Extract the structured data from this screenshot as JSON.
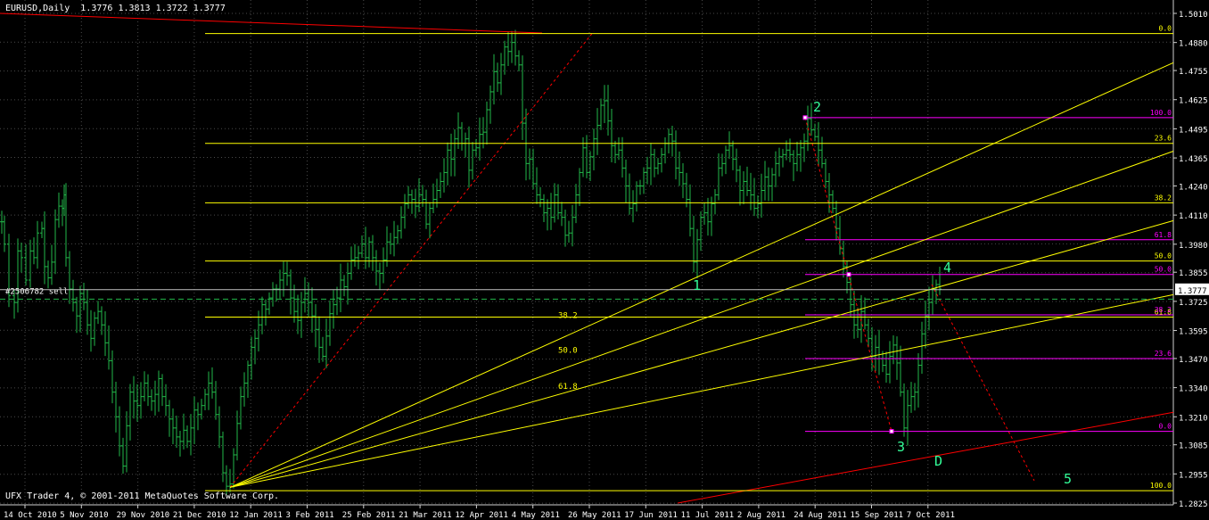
{
  "header": {
    "symbol_tf": "EURUSD,Daily",
    "ohlc": "1.3776 1.3813 1.3722 1.3777"
  },
  "footer": "UFX Trader 4, © 2001-2011 MetaQuotes Software Corp.",
  "colors": {
    "background": "#000000",
    "bars": "#22b84a",
    "grid": "#4a4a4a",
    "axis_text": "#ffffff",
    "fib_yellow": "#ffff00",
    "fib_magenta": "#ff00ff",
    "trend_red": "#ff0000",
    "wave_labels": "#33ff99",
    "price_tag_bg": "#ffffff"
  },
  "chart_data": {
    "type": "ohlc",
    "symbol": "EURUSD",
    "timeframe": "Daily",
    "grid": true,
    "current_price": "1.3777",
    "y_ticks": [
      "1.5010",
      "1.4880",
      "1.4755",
      "1.4625",
      "1.4495",
      "1.4365",
      "1.4240",
      "1.4110",
      "1.3980",
      "1.3855",
      "1.3725",
      "1.3595",
      "1.3470",
      "1.3340",
      "1.3210",
      "1.3085",
      "1.2955",
      "1.2825"
    ],
    "x_ticks": [
      "14 Oct 2010",
      "5 Nov 2010",
      "29 Nov 2010",
      "21 Dec 2010",
      "12 Jan 2011",
      "3 Feb 2011",
      "25 Feb 2011",
      "21 Mar 2011",
      "12 Apr 2011",
      "4 May 2011",
      "26 May 2011",
      "17 Jun 2011",
      "11 Jul 2011",
      "2 Aug 2011",
      "24 Aug 2011",
      "15 Sep 2011",
      "7 Oct 2011"
    ],
    "ylim": [
      1.2825,
      1.501
    ],
    "close_series": [
      [
        0,
        1.408
      ],
      [
        3,
        1.398
      ],
      [
        8,
        1.375
      ],
      [
        14,
        1.372
      ],
      [
        18,
        1.395
      ],
      [
        22,
        1.392
      ],
      [
        27,
        1.382
      ],
      [
        32,
        1.395
      ],
      [
        36,
        1.392
      ],
      [
        40,
        1.403
      ],
      [
        45,
        1.405
      ],
      [
        48,
        1.388
      ],
      [
        52,
        1.383
      ],
      [
        56,
        1.39
      ],
      [
        60,
        1.409
      ],
      [
        64,
        1.415
      ],
      [
        68,
        1.414
      ],
      [
        70,
        1.42
      ],
      [
        72,
        1.392
      ],
      [
        76,
        1.378
      ],
      [
        80,
        1.372
      ],
      [
        84,
        1.366
      ],
      [
        88,
        1.376
      ],
      [
        92,
        1.372
      ],
      [
        96,
        1.362
      ],
      [
        100,
        1.356
      ],
      [
        104,
        1.365
      ],
      [
        108,
        1.368
      ],
      [
        112,
        1.362
      ],
      [
        116,
        1.354
      ],
      [
        120,
        1.346
      ],
      [
        124,
        1.332
      ],
      [
        128,
        1.321
      ],
      [
        132,
        1.308
      ],
      [
        136,
        1.299
      ],
      [
        140,
        1.317
      ],
      [
        144,
        1.332
      ],
      [
        148,
        1.328
      ],
      [
        152,
        1.326
      ],
      [
        156,
        1.33
      ],
      [
        160,
        1.336
      ],
      [
        164,
        1.33
      ],
      [
        168,
        1.328
      ],
      [
        172,
        1.331
      ],
      [
        176,
        1.338
      ],
      [
        180,
        1.33
      ],
      [
        184,
        1.326
      ],
      [
        188,
        1.32
      ],
      [
        192,
        1.316
      ],
      [
        196,
        1.312
      ],
      [
        200,
        1.31
      ],
      [
        204,
        1.315
      ],
      [
        208,
        1.31
      ],
      [
        212,
        1.316
      ],
      [
        216,
        1.324
      ],
      [
        220,
        1.322
      ],
      [
        224,
        1.326
      ],
      [
        228,
        1.331
      ],
      [
        232,
        1.336
      ],
      [
        236,
        1.332
      ],
      [
        240,
        1.322
      ],
      [
        244,
        1.312
      ],
      [
        248,
        1.296
      ],
      [
        252,
        1.29
      ],
      [
        256,
        1.291
      ],
      [
        260,
        1.304
      ],
      [
        264,
        1.318
      ],
      [
        268,
        1.33
      ],
      [
        272,
        1.336
      ],
      [
        276,
        1.344
      ],
      [
        280,
        1.352
      ],
      [
        284,
        1.356
      ],
      [
        288,
        1.362
      ],
      [
        292,
        1.371
      ],
      [
        296,
        1.369
      ],
      [
        300,
        1.374
      ],
      [
        304,
        1.378
      ],
      [
        308,
        1.378
      ],
      [
        312,
        1.382
      ],
      [
        316,
        1.385
      ],
      [
        320,
        1.384
      ],
      [
        324,
        1.374
      ],
      [
        328,
        1.368
      ],
      [
        332,
        1.364
      ],
      [
        336,
        1.372
      ],
      [
        340,
        1.376
      ],
      [
        344,
        1.372
      ],
      [
        348,
        1.366
      ],
      [
        352,
        1.36
      ],
      [
        356,
        1.352
      ],
      [
        360,
        1.348
      ],
      [
        364,
        1.357
      ],
      [
        368,
        1.367
      ],
      [
        372,
        1.371
      ],
      [
        376,
        1.374
      ],
      [
        380,
        1.382
      ],
      [
        384,
        1.379
      ],
      [
        388,
        1.385
      ],
      [
        392,
        1.391
      ],
      [
        396,
        1.392
      ],
      [
        400,
        1.394
      ],
      [
        404,
        1.398
      ],
      [
        408,
        1.392
      ],
      [
        412,
        1.399
      ],
      [
        416,
        1.392
      ],
      [
        420,
        1.386
      ],
      [
        424,
        1.385
      ],
      [
        428,
        1.391
      ],
      [
        432,
        1.399
      ],
      [
        436,
        1.398
      ],
      [
        440,
        1.401
      ],
      [
        444,
        1.404
      ],
      [
        448,
        1.41
      ],
      [
        452,
        1.416
      ],
      [
        456,
        1.42
      ],
      [
        460,
        1.418
      ],
      [
        464,
        1.415
      ],
      [
        468,
        1.42
      ],
      [
        472,
        1.418
      ],
      [
        476,
        1.407
      ],
      [
        480,
        1.414
      ],
      [
        484,
        1.418
      ],
      [
        488,
        1.422
      ],
      [
        492,
        1.426
      ],
      [
        496,
        1.43
      ],
      [
        500,
        1.44
      ],
      [
        504,
        1.436
      ],
      [
        508,
        1.445
      ],
      [
        512,
        1.45
      ],
      [
        516,
        1.443
      ],
      [
        520,
        1.445
      ],
      [
        524,
        1.431
      ],
      [
        528,
        1.44
      ],
      [
        532,
        1.441
      ],
      [
        536,
        1.447
      ],
      [
        540,
        1.448
      ],
      [
        544,
        1.458
      ],
      [
        548,
        1.466
      ],
      [
        552,
        1.475
      ],
      [
        556,
        1.47
      ],
      [
        560,
        1.478
      ],
      [
        564,
        1.486
      ],
      [
        568,
        1.484
      ],
      [
        572,
        1.488
      ],
      [
        576,
        1.482
      ],
      [
        580,
        1.478
      ],
      [
        584,
        1.452
      ],
      [
        588,
        1.434
      ],
      [
        592,
        1.436
      ],
      [
        596,
        1.425
      ],
      [
        600,
        1.42
      ],
      [
        604,
        1.418
      ],
      [
        608,
        1.412
      ],
      [
        612,
        1.414
      ],
      [
        616,
        1.41
      ],
      [
        620,
        1.42
      ],
      [
        624,
        1.412
      ],
      [
        628,
        1.41
      ],
      [
        632,
        1.402
      ],
      [
        636,
        1.403
      ],
      [
        640,
        1.41
      ],
      [
        644,
        1.42
      ],
      [
        648,
        1.43
      ],
      [
        652,
        1.441
      ],
      [
        656,
        1.43
      ],
      [
        660,
        1.437
      ],
      [
        664,
        1.445
      ],
      [
        668,
        1.451
      ],
      [
        672,
        1.46
      ],
      [
        676,
        1.462
      ],
      [
        680,
        1.453
      ],
      [
        684,
        1.442
      ],
      [
        688,
        1.438
      ],
      [
        692,
        1.44
      ],
      [
        696,
        1.432
      ],
      [
        700,
        1.424
      ],
      [
        704,
        1.414
      ],
      [
        708,
        1.416
      ],
      [
        712,
        1.424
      ],
      [
        716,
        1.424
      ],
      [
        720,
        1.43
      ],
      [
        724,
        1.432
      ],
      [
        728,
        1.438
      ],
      [
        732,
        1.432
      ],
      [
        736,
        1.434
      ],
      [
        740,
        1.438
      ],
      [
        744,
        1.443
      ],
      [
        748,
        1.447
      ],
      [
        752,
        1.444
      ],
      [
        756,
        1.432
      ],
      [
        760,
        1.43
      ],
      [
        764,
        1.425
      ],
      [
        768,
        1.418
      ],
      [
        772,
        1.405
      ],
      [
        776,
        1.39
      ],
      [
        780,
        1.4
      ],
      [
        784,
        1.41
      ],
      [
        788,
        1.412
      ],
      [
        792,
        1.408
      ],
      [
        796,
        1.416
      ],
      [
        800,
        1.42
      ],
      [
        804,
        1.432
      ],
      [
        808,
        1.434
      ],
      [
        812,
        1.44
      ],
      [
        816,
        1.442
      ],
      [
        820,
        1.436
      ],
      [
        824,
        1.431
      ],
      [
        828,
        1.422
      ],
      [
        832,
        1.426
      ],
      [
        836,
        1.422
      ],
      [
        840,
        1.42
      ],
      [
        844,
        1.414
      ],
      [
        848,
        1.416
      ],
      [
        852,
        1.422
      ],
      [
        856,
        1.428
      ],
      [
        860,
        1.424
      ],
      [
        864,
        1.429
      ],
      [
        868,
        1.434
      ],
      [
        872,
        1.437
      ],
      [
        876,
        1.438
      ],
      [
        880,
        1.44
      ],
      [
        884,
        1.438
      ],
      [
        888,
        1.434
      ],
      [
        892,
        1.438
      ],
      [
        896,
        1.441
      ],
      [
        900,
        1.444
      ],
      [
        904,
        1.454
      ],
      [
        908,
        1.449
      ],
      [
        912,
        1.446
      ],
      [
        916,
        1.44
      ],
      [
        920,
        1.434
      ],
      [
        924,
        1.426
      ],
      [
        928,
        1.42
      ],
      [
        932,
        1.414
      ],
      [
        936,
        1.405
      ],
      [
        940,
        1.396
      ],
      [
        944,
        1.388
      ],
      [
        948,
        1.381
      ],
      [
        952,
        1.371
      ],
      [
        956,
        1.362
      ],
      [
        960,
        1.36
      ],
      [
        964,
        1.368
      ],
      [
        968,
        1.362
      ],
      [
        972,
        1.356
      ],
      [
        976,
        1.348
      ],
      [
        980,
        1.352
      ],
      [
        984,
        1.347
      ],
      [
        988,
        1.344
      ],
      [
        992,
        1.34
      ],
      [
        996,
        1.348
      ],
      [
        1000,
        1.353
      ],
      [
        1004,
        1.345
      ],
      [
        1008,
        1.332
      ],
      [
        1012,
        1.316
      ],
      [
        1016,
        1.326
      ],
      [
        1020,
        1.33
      ],
      [
        1024,
        1.332
      ],
      [
        1028,
        1.344
      ],
      [
        1032,
        1.358
      ],
      [
        1036,
        1.366
      ],
      [
        1040,
        1.372
      ],
      [
        1044,
        1.378
      ],
      [
        1048,
        1.38
      ],
      [
        1052,
        1.378
      ]
    ],
    "fib_levels_yellow": [
      {
        "label": "0.0",
        "price": 1.492,
        "x1": 230,
        "x2": 1316
      },
      {
        "label": "23.6",
        "price": 1.443,
        "x1": 230,
        "x2": 1316
      },
      {
        "label": "38.2",
        "price": 1.4165,
        "x1": 230,
        "x2": 1316
      },
      {
        "label": "50.0",
        "price": 1.3905,
        "x1": 230,
        "x2": 1316
      },
      {
        "label": "61.8",
        "price": 1.3655,
        "x1": 230,
        "x2": 1316
      },
      {
        "label": "100.0",
        "price": 1.288,
        "x1": 230,
        "x2": 1316
      }
    ],
    "fib_levels_magenta": [
      {
        "label": "100.0",
        "price": 1.4545,
        "x1": 903,
        "x2": 1316
      },
      {
        "label": "61.8",
        "price": 1.4,
        "x1": 903,
        "x2": 1316
      },
      {
        "label": "50.0",
        "price": 1.3845,
        "x1": 903,
        "x2": 1316
      },
      {
        "label": "38.2",
        "price": 1.3665,
        "x1": 903,
        "x2": 1316
      },
      {
        "label": "23.6",
        "price": 1.347,
        "x1": 903,
        "x2": 1316
      },
      {
        "label": "0.0",
        "price": 1.3145,
        "x1": 903,
        "x2": 1316
      }
    ],
    "fan_labels": [
      "38.2",
      "50.0",
      "61.8"
    ],
    "wave_labels": [
      "1",
      "2",
      "3",
      "4",
      "5",
      "D"
    ],
    "order_line": {
      "label": "#2506782 sell",
      "price": 1.3735
    },
    "magenta_short_label": "38.2"
  }
}
